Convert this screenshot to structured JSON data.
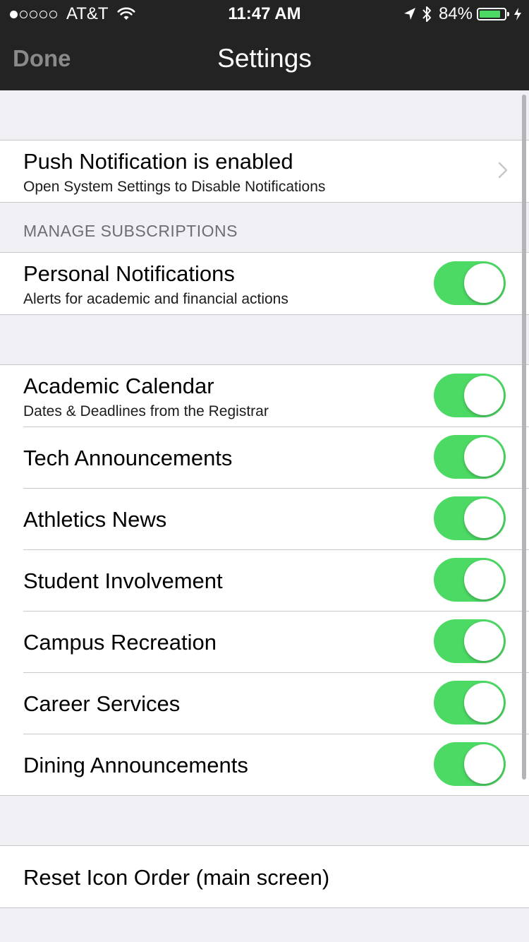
{
  "status_bar": {
    "carrier": "AT&T",
    "time": "11:47 AM",
    "battery": "84%",
    "battery_level": 0.84,
    "signal_bars": 1,
    "signal_total": 5
  },
  "nav": {
    "done_label": "Done",
    "title": "Settings"
  },
  "push": {
    "title": "Push Notification is enabled",
    "subtitle": "Open System Settings to Disable Notifications"
  },
  "subscriptions": {
    "header": "MANAGE SUBSCRIPTIONS",
    "personal": {
      "title": "Personal Notifications",
      "subtitle": "Alerts for academic and financial actions",
      "enabled": true
    }
  },
  "topics": [
    {
      "title": "Academic Calendar",
      "subtitle": "Dates & Deadlines from the Registrar",
      "enabled": true
    },
    {
      "title": "Tech Announcements",
      "enabled": true
    },
    {
      "title": "Athletics News",
      "enabled": true
    },
    {
      "title": "Student Involvement",
      "enabled": true
    },
    {
      "title": "Campus Recreation",
      "enabled": true
    },
    {
      "title": "Career Services",
      "enabled": true
    },
    {
      "title": "Dining Announcements",
      "enabled": true
    }
  ],
  "reset": {
    "title": "Reset Icon Order (main screen)"
  },
  "colors": {
    "toggle_on": "#4cd964",
    "bar_background": "#232323",
    "group_background": "#efeff4"
  }
}
